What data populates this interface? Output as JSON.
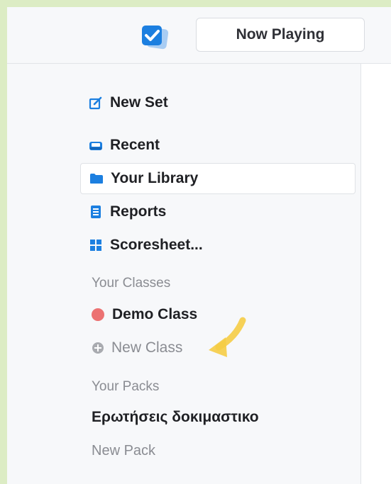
{
  "header": {
    "now_playing_label": "Now Playing"
  },
  "sidebar": {
    "nav_items": [
      {
        "label": "New Set",
        "icon": "edit-icon"
      },
      {
        "label": "Recent",
        "icon": "recent-icon"
      },
      {
        "label": "Your Library",
        "icon": "folder-icon",
        "selected": true
      },
      {
        "label": "Reports",
        "icon": "reports-icon"
      },
      {
        "label": "Scoresheet...",
        "icon": "grid-icon"
      }
    ],
    "classes_heading": "Your Classes",
    "classes": [
      {
        "label": "Demo Class",
        "color": "#ec7272"
      }
    ],
    "new_class_label": "New Class",
    "packs_heading": "Your Packs",
    "packs": [
      {
        "label": "Ερωτήσεις δοκιμαστικο"
      }
    ],
    "new_pack_label": "New Pack"
  },
  "colors": {
    "accent": "#1c7fe0",
    "annotation_arrow": "#f5cc45",
    "page_background": "#dcecc4"
  }
}
